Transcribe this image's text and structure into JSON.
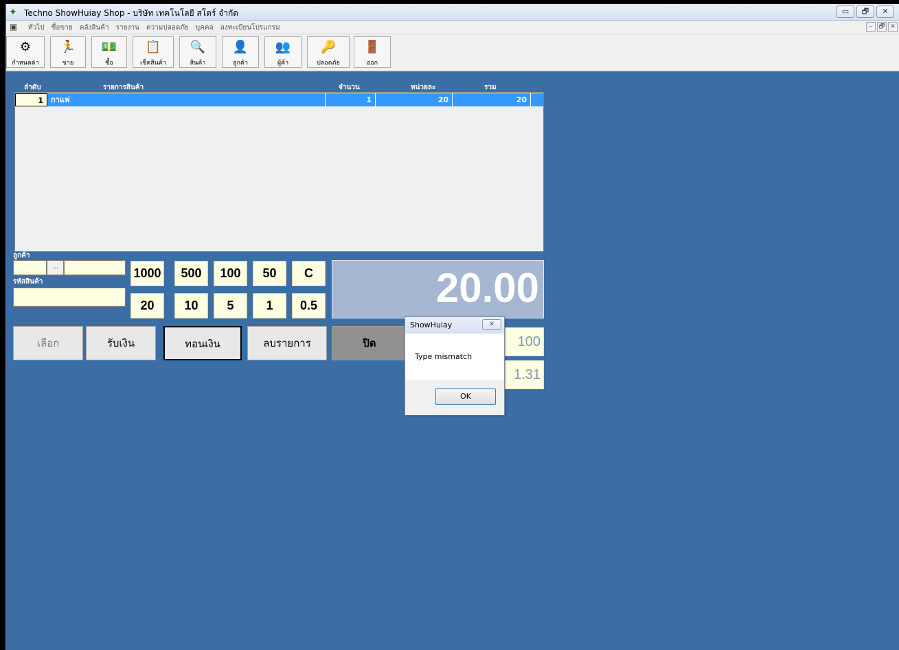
{
  "window": {
    "title": "Techno ShowHuiay Shop - บริษัท เทคโนโลยี สโตร์ จำกัด",
    "controls": [
      "▭",
      "🗗",
      "✕"
    ],
    "mdi_controls": [
      "–",
      "🗗",
      "✕"
    ]
  },
  "menu": [
    "ทั่วไป",
    "ซื้อขาย",
    "คลังสินค้า",
    "รายงาน",
    "ความปลอดภัย",
    "บุคคล",
    "ลงทะเบียนโปรแกรม"
  ],
  "toolbar": [
    {
      "label": "กำหนดค่า",
      "icon": "settings-icon",
      "glyph": "⚙"
    },
    {
      "label": "ขาย",
      "icon": "runner-icon",
      "glyph": "🏃"
    },
    {
      "label": "ซื้อ",
      "icon": "money-icon",
      "glyph": "💵"
    },
    {
      "label": "เช็คสินค้า",
      "icon": "checklist-icon",
      "glyph": "📋"
    },
    {
      "label": "สินค้า",
      "icon": "magnifier-icon",
      "glyph": "🔍"
    },
    {
      "label": "ลูกค้า",
      "icon": "customer-icon",
      "glyph": "👤"
    },
    {
      "label": "ผู้ค้า",
      "icon": "supplier-icon",
      "glyph": "👥"
    },
    {
      "label": "ปลอดภัย",
      "icon": "keys-icon",
      "glyph": "🔑"
    },
    {
      "label": "ออก",
      "icon": "exit-door-icon",
      "glyph": "🚪"
    }
  ],
  "grid": {
    "headers": {
      "no": "ลำดับ",
      "item": "รายการสินค้า",
      "qty": "จำนวน",
      "unit": "หน่วยละ",
      "total": "รวม"
    },
    "rows": [
      {
        "no": "1",
        "item": "กาแฟ",
        "qty": "1",
        "unit": "20",
        "total": "20"
      }
    ]
  },
  "form": {
    "customer_label": "ลูกค้า",
    "browse_label": "...",
    "product_code_label": "รหัสสินค้า"
  },
  "keypad": {
    "row1": [
      "1000",
      "500",
      "100",
      "50",
      "C"
    ],
    "row2": [
      "20",
      "10",
      "5",
      "1",
      "0.5"
    ]
  },
  "display": {
    "total": "20.00",
    "received": "100",
    "change": "1.31"
  },
  "actions": {
    "select": "เลือก",
    "receive": "รับเงิน",
    "change": "ทอนเงิน",
    "delete": "ลบรายการ",
    "close": "ปิด"
  },
  "dialog": {
    "title": "ShowHuiay",
    "message": "Type mismatch",
    "ok": "OK",
    "close_glyph": "✕"
  },
  "colors": {
    "background": "#3b6ea5",
    "selection": "#3399ff",
    "input_bg": "#ffffe1",
    "display_bg": "#a5b7d1"
  }
}
